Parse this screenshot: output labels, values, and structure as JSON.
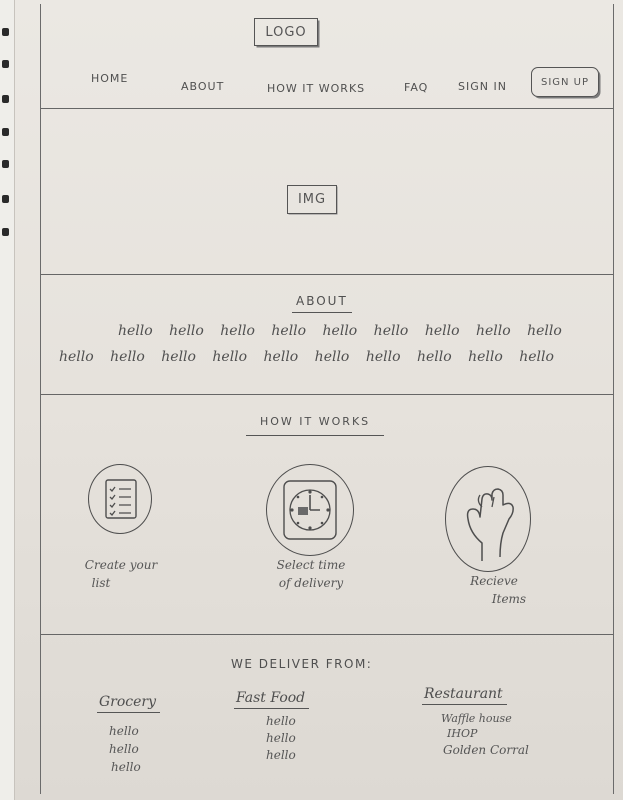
{
  "header": {
    "logo": "LOGO",
    "nav": [
      {
        "label": "HOME"
      },
      {
        "label": "ABOUT"
      },
      {
        "label": "HOW IT WORKS"
      },
      {
        "label": "FAQ"
      },
      {
        "label": "SIGN IN"
      }
    ],
    "signup_label": "SIGN UP"
  },
  "hero": {
    "image_placeholder": "IMG"
  },
  "about": {
    "title": "ABOUT",
    "line1": "hello hello hello hello hello hello hello hello hello",
    "line2": "hello hello hello hello hello hello hello hello hello hello"
  },
  "how_it_works": {
    "title": "HOW IT WORKS",
    "steps": [
      {
        "icon": "checklist-icon",
        "caption_line1": "Create your",
        "caption_line2": "list"
      },
      {
        "icon": "clock-icon",
        "caption_line1": "Select time",
        "caption_line2": "of delivery"
      },
      {
        "icon": "hand-icon",
        "caption_line1": "Recieve",
        "caption_line2": "Items"
      }
    ]
  },
  "deliver": {
    "title": "WE DELIVER FROM:",
    "columns": [
      {
        "heading": "Grocery",
        "items": [
          "hello",
          "hello",
          "hello"
        ]
      },
      {
        "heading": "Fast Food",
        "items": [
          "hello",
          "hello",
          "hello"
        ]
      },
      {
        "heading": "Restaurant",
        "items": [
          "Waffle house",
          "IHOP",
          "Golden Corral"
        ]
      }
    ]
  }
}
